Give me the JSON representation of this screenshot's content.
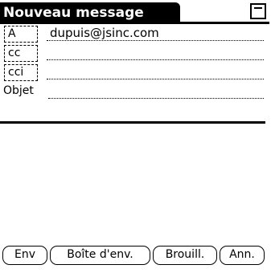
{
  "app": {
    "title": "Nouveau message"
  },
  "fields": {
    "to": {
      "label": "A",
      "value": "dupuis@jsinc.com"
    },
    "cc": {
      "label": "cc",
      "value": ""
    },
    "bcc": {
      "label": "cci",
      "value": ""
    },
    "subject": {
      "label": "Objet",
      "value": ""
    }
  },
  "body": {
    "text": ""
  },
  "buttons": {
    "send": "Env",
    "outbox": "Boîte d'env.",
    "drafts": "Brouill.",
    "cancel": "Ann."
  },
  "icons": {
    "menu": "menu-icon"
  },
  "colors": {
    "foreground": "#000000",
    "background": "#ffffff"
  }
}
